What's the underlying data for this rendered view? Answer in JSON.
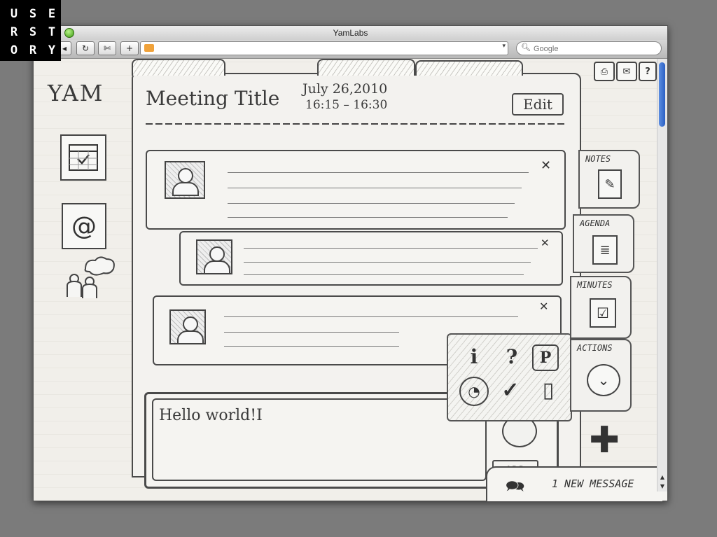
{
  "brand_logo": {
    "rows": [
      [
        "U",
        "S",
        "E"
      ],
      [
        "R",
        "S",
        "T"
      ],
      [
        "O",
        "R",
        "Y"
      ]
    ]
  },
  "browser": {
    "window_title": "YamLabs",
    "search_placeholder": "Google",
    "toolbar_icons": [
      "back-icon",
      "reload-icon",
      "screenshot-icon",
      "new-tab-icon"
    ]
  },
  "app": {
    "logo_text": "YAM",
    "meeting": {
      "title": "Meeting Title",
      "date": "July 26,2010",
      "time": "16:15 – 16:30",
      "edit_label": "Edit"
    },
    "side_tabs": [
      {
        "label": "NOTES",
        "icon": "notes-icon"
      },
      {
        "label": "AGENDA",
        "icon": "agenda-icon"
      },
      {
        "label": "MINUTES",
        "icon": "minutes-icon"
      },
      {
        "label": "ACTIONS",
        "icon": "actions-icon"
      }
    ],
    "composer": {
      "text": "Hello world!I",
      "add_label": "ADD"
    },
    "footer": {
      "message_count_text": "1 NEW MESSAGE"
    }
  },
  "colors": {
    "pencil": "#3a3a3a",
    "paper": "#f4f3f0",
    "scroll_thumb": "#2a5fc4"
  }
}
